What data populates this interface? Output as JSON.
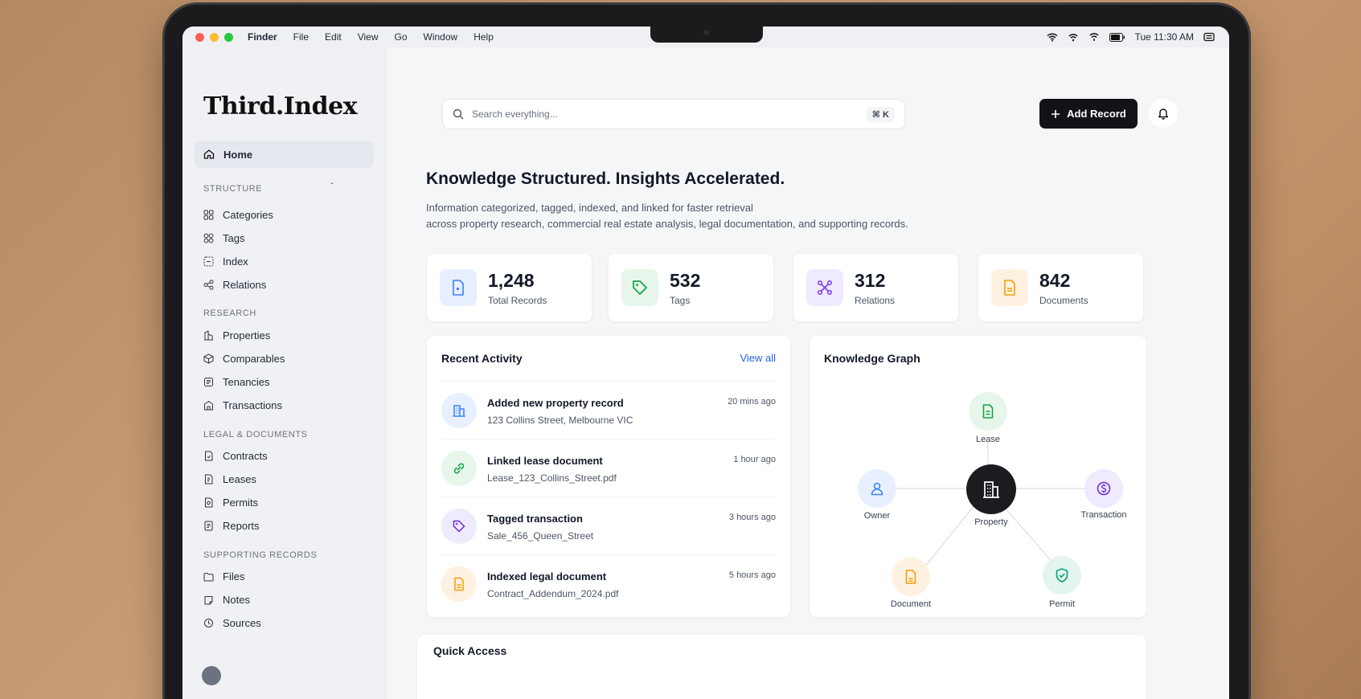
{
  "menubar": {
    "app": "Finder",
    "items": [
      "File",
      "Edit",
      "View",
      "Go",
      "Window",
      "Help"
    ],
    "clock": "Tue 11:30 AM"
  },
  "sidebar": {
    "logo": "Third.Index",
    "home": "Home",
    "sections": [
      {
        "title": "STRUCTURE",
        "items": [
          "Categories",
          "Tags",
          "Index",
          "Relations"
        ]
      },
      {
        "title": "RESEARCH",
        "items": [
          "Properties",
          "Comparables",
          "Tenancies",
          "Transactions"
        ]
      },
      {
        "title": "LEGAL & DOCUMENTS",
        "items": [
          "Contracts",
          "Leases",
          "Permits",
          "Reports"
        ]
      },
      {
        "title": "SUPPORTING RECORDS",
        "items": [
          "Files",
          "Notes",
          "Sources"
        ]
      }
    ]
  },
  "search": {
    "placeholder": "Search everything...",
    "shortcut": "⌘ K"
  },
  "add_button": "Add Record",
  "hero": {
    "title": "Knowledge Structured. Insights Accelerated.",
    "line1": "Information categorized, tagged, indexed, and linked for faster retrieval",
    "line2": "across property research, commercial real estate analysis, legal documentation, and supporting records."
  },
  "stats": [
    {
      "value": "1,248",
      "label": "Total Records",
      "icon": "document-icon",
      "color": "#3b82f6",
      "bg": "#e8efff"
    },
    {
      "value": "532",
      "label": "Tags",
      "icon": "tag-icon",
      "color": "#16a34a",
      "bg": "#e6f6ea"
    },
    {
      "value": "312",
      "label": "Relations",
      "icon": "network-icon",
      "color": "#7c3aed",
      "bg": "#efeafd"
    },
    {
      "value": "842",
      "label": "Documents",
      "icon": "file-icon",
      "color": "#f59e0b",
      "bg": "#fff1e1"
    }
  ],
  "activity": {
    "title": "Recent Activity",
    "view_all": "View all",
    "items": [
      {
        "title": "Added new property record",
        "sub": "123 Collins Street, Melbourne VIC",
        "time": "20 mins ago"
      },
      {
        "title": "Linked lease document",
        "sub": "Lease_123_Collins_Street.pdf",
        "time": "1 hour ago"
      },
      {
        "title": "Tagged transaction",
        "sub": "Sale_456_Queen_Street",
        "time": "3 hours ago"
      },
      {
        "title": "Indexed legal document",
        "sub": "Contract_Addendum_2024.pdf",
        "time": "5 hours ago"
      }
    ]
  },
  "graph": {
    "title": "Knowledge Graph",
    "center": "Property",
    "nodes": {
      "lease": "Lease",
      "owner": "Owner",
      "transaction": "Transaction",
      "document": "Document",
      "permit": "Permit"
    }
  },
  "quick_access": {
    "title": "Quick Access"
  }
}
